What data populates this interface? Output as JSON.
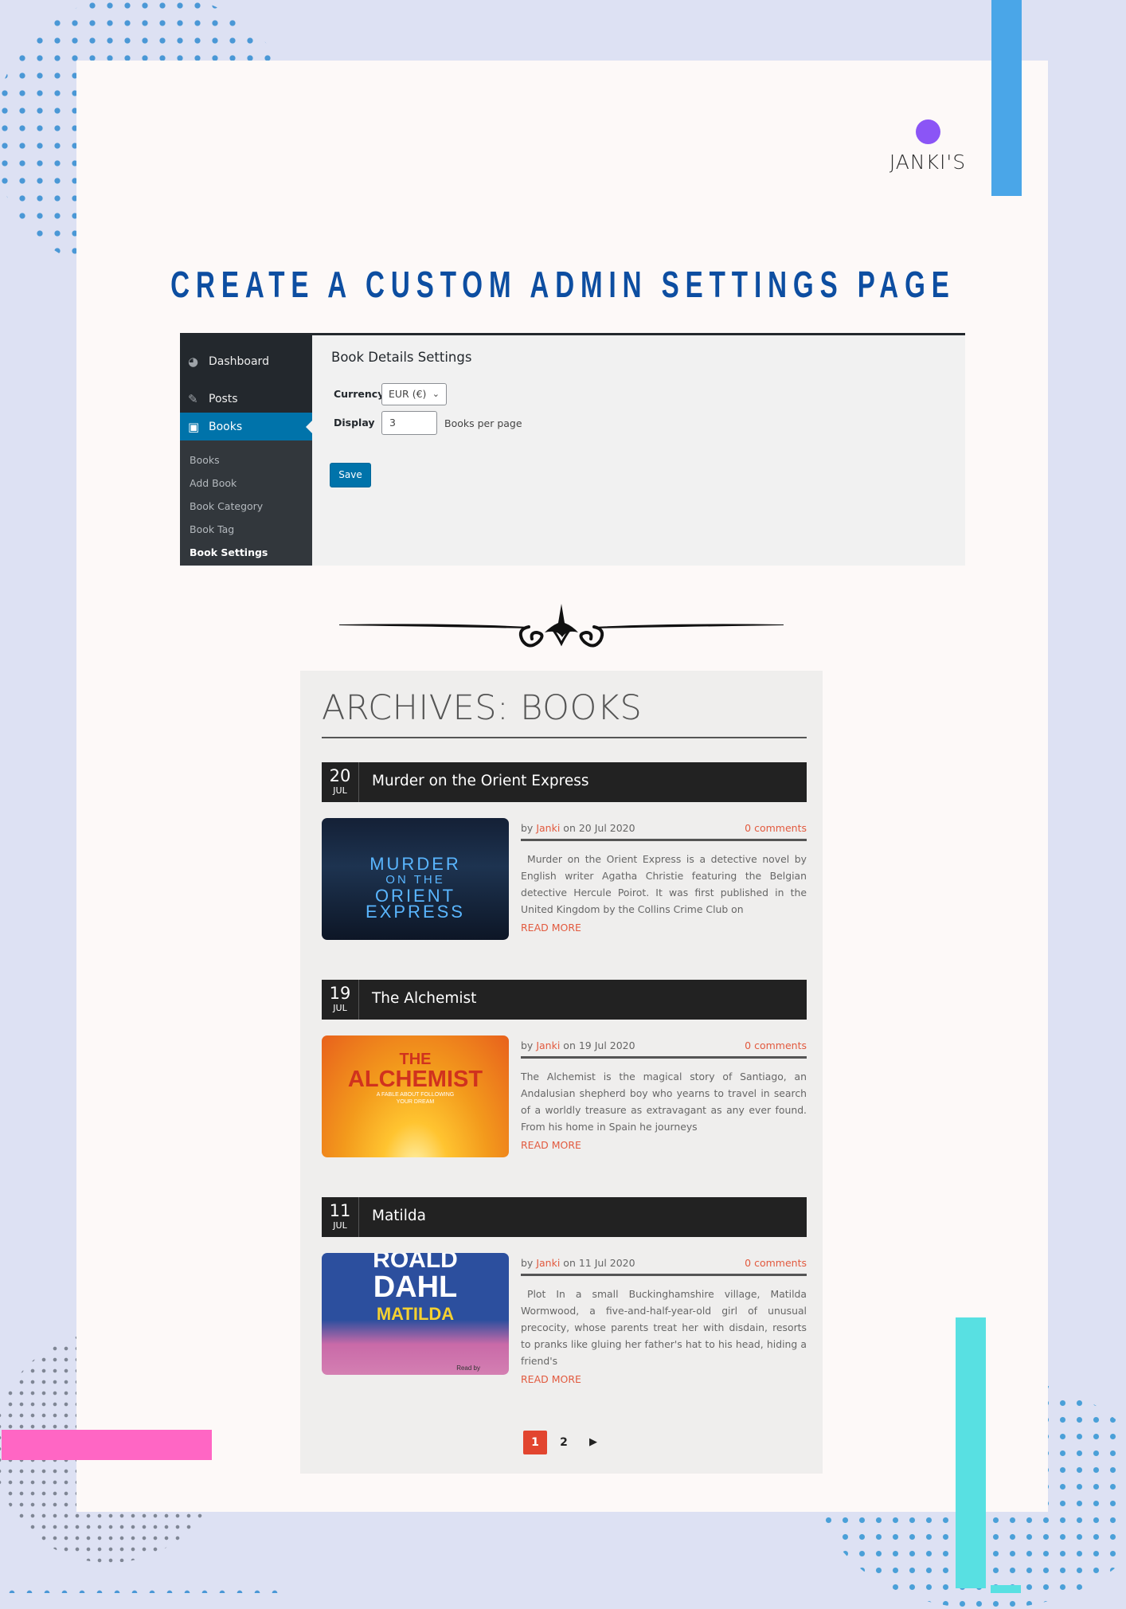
{
  "brand": {
    "name": "JANKI'S"
  },
  "page": {
    "title": "CREATE A CUSTOM ADMIN SETTINGS PAGE"
  },
  "admin": {
    "menu": [
      {
        "label": "Dashboard",
        "icon": "dashboard-icon"
      },
      {
        "label": "Posts",
        "icon": "pin-icon"
      },
      {
        "label": "Books",
        "icon": "book-icon",
        "active": true
      }
    ],
    "submenu": [
      "Books",
      "Add Book",
      "Book Category",
      "Book Tag",
      "Book Settings"
    ],
    "current_submenu": "Book Settings",
    "heading": "Book Details Settings",
    "currency_label": "Currency",
    "currency_value": "EUR (€)",
    "display_label": "Display",
    "display_value": "3",
    "display_suffix": "Books per page",
    "save_label": "Save",
    "colors": {
      "sidebar": "#23282d",
      "accent": "#0073aa"
    }
  },
  "archive": {
    "title": "ARCHIVES: BOOKS",
    "posts": [
      {
        "day": "20",
        "month": "JUL",
        "title": "Murder on the Orient Express",
        "author_prefix": "by",
        "author": "Janki",
        "date_text": "on 20 Jul 2020",
        "comments": "0 comments",
        "excerpt": "Murder on the Orient Express is a detective novel by English writer Agatha Christie featuring the Belgian detective Hercule Poirot. It was first published in the United Kingdom by the Collins Crime Club on",
        "read_more": "READ MORE",
        "thumb_lines": [
          "MURDER",
          "ON THE",
          "ORIENT",
          "EXPRESS"
        ]
      },
      {
        "day": "19",
        "month": "JUL",
        "title": "The Alchemist",
        "author_prefix": "by",
        "author": "Janki",
        "date_text": "on 19 Jul 2020",
        "comments": "0 comments",
        "excerpt": "The Alchemist is the magical story of Santiago, an Andalusian shepherd boy who yearns to travel in search of a worldly treasure as extravagant as any ever found. From his home in Spain he journeys",
        "read_more": "READ MORE",
        "thumb_lines": [
          "THE",
          "ALCHEMIST",
          "A FABLE ABOUT FOLLOWING",
          "YOUR DREAM"
        ]
      },
      {
        "day": "11",
        "month": "JUL",
        "title": "Matilda",
        "author_prefix": "by",
        "author": "Janki",
        "date_text": "on 11 Jul 2020",
        "comments": "0 comments",
        "excerpt": "Plot In a small Buckinghamshire village, Matilda Wormwood, a five-and-half-year-old girl of unusual precocity, whose parents treat her with disdain, resorts to pranks like gluing her father's hat to his head, hiding a friend's",
        "read_more": "READ MORE",
        "thumb_lines": [
          "ROALD",
          "DAHL",
          "MATILDA",
          "Read by"
        ]
      }
    ],
    "pagination": {
      "current": "1",
      "next_page": "2",
      "next_icon": "next-arrow-icon"
    },
    "colors": {
      "link": "#e25a3f",
      "header": "#222222"
    }
  },
  "decor": {
    "colors": {
      "blue": "#4aa6e8",
      "pink": "#ff66c4",
      "cyan": "#58e0e2",
      "purple": "#8b55f6",
      "title": "#0d4ea1"
    }
  }
}
